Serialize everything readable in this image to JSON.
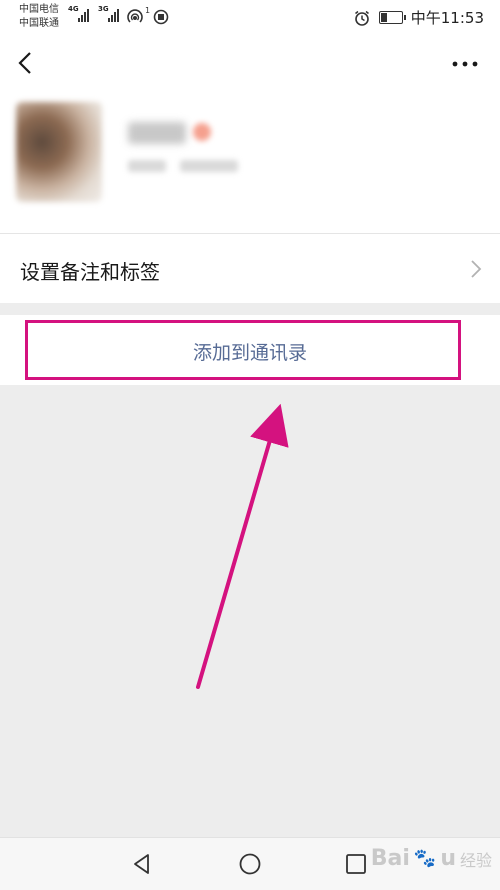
{
  "status_bar": {
    "carrier_1": "中国电信",
    "carrier_2": "中国联通",
    "signal_1_tag": "4G",
    "signal_2_tag": "3G",
    "hotspot_count": "1",
    "time": "中午11:53",
    "battery_level_percent": 35
  },
  "nav": {
    "back_icon": "chevron-left-icon",
    "more_icon": "ellipsis-icon"
  },
  "profile": {
    "avatar_icon": "avatar-blurred"
  },
  "menu": {
    "remark_label": "设置备注和标签",
    "add_contact_label": "添加到通讯录"
  },
  "annotation": {
    "highlight_color": "#d4127f"
  },
  "colors": {
    "link": "#576b95",
    "page_bg": "#ededed"
  },
  "system_nav": {
    "back_icon": "triangle-back-icon",
    "home_icon": "circle-home-icon",
    "recent_icon": "square-recent-icon"
  },
  "watermark": {
    "brand": "Bai",
    "brand_tail": "u",
    "cn": "经验"
  }
}
